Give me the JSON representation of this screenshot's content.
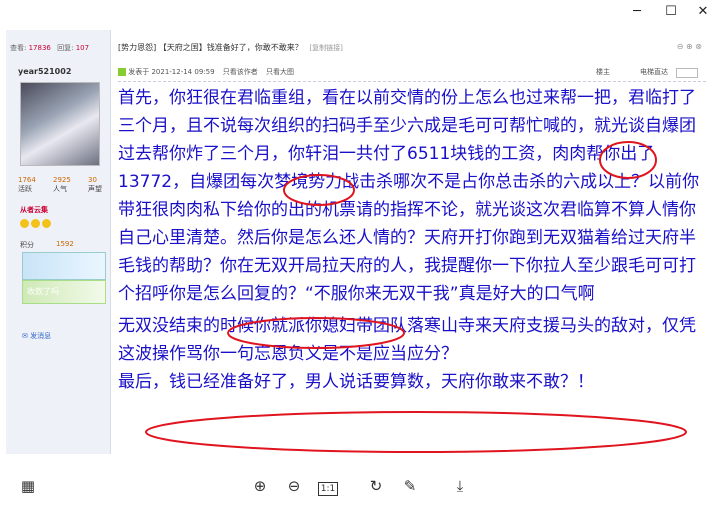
{
  "window": {
    "minimize": "─",
    "maximize": "☐",
    "close": "✕"
  },
  "sidebar": {
    "views_label": "查看:",
    "views": "17836",
    "replies_label": "回复:",
    "replies": "107",
    "username": "year521002",
    "stats": [
      {
        "value": "1764",
        "label": "活跃"
      },
      {
        "value": "2925",
        "label": "人气"
      },
      {
        "value": "30",
        "label": "声望"
      }
    ],
    "group": "从者云集",
    "points_label": "积分",
    "points": "1592",
    "banner_text": "收款了吗",
    "message_link": "发消息"
  },
  "post": {
    "title": "[势力恩怨] 【天府之国】钱准备好了，你敢不敢来？",
    "copy_link": "[复制链接]",
    "meta_posted": "发表于 2021-12-14 09:59",
    "meta_author_only": "只看该作者",
    "meta_big_image": "只看大图",
    "meta_floor": "楼主",
    "meta_mode": "电梯直达",
    "paragraph1": "首先，你狂很在君临重组，看在以前交情的份上怎么也过来帮一把，君临打了三个月，且不说每次组织的扫码手至少六成是毛可可帮忙喊的，就光谈自爆团过去帮你炸了三个月，你轩泪一共付了6511块钱的工资，肉肉帮你出了13772，自爆团每次梦境势力战击杀哪次不是占你总击杀的六成以上？以前你带狂很肉肉私下给你的出的机票请的指挥不论，就光谈这次君临算不算人情你自己心里清楚。然后你是怎么还人情的？天府开打你跑到无双猫着给过天府半毛钱的帮助？你在无双开局拉天府的人，我提醒你一下你拉人至少跟毛可可打个招呼你是怎么回复的？“不服你来无双干我”真是好大的口气啊",
    "paragraph2": "无双没结束的时候你就派你媳妇带团队落寒山寺来天府支援马头的敌对，仅凭这波操作骂你一句忘恩负义是不是应当应分？",
    "paragraph3": "最后，钱已经准备好了，男人说话要算数，天府你敢来不敢？！"
  },
  "toolbar": {
    "grid_icon": "▦",
    "zoom_in_icon": "⊕",
    "zoom_out_icon": "⊖",
    "actual_size": "1:1",
    "rotate_icon": "↻",
    "edit_icon": "✎",
    "save_icon": "⤓"
  },
  "colors": {
    "text": "#1a10c8",
    "annotation": "#e0141e"
  }
}
